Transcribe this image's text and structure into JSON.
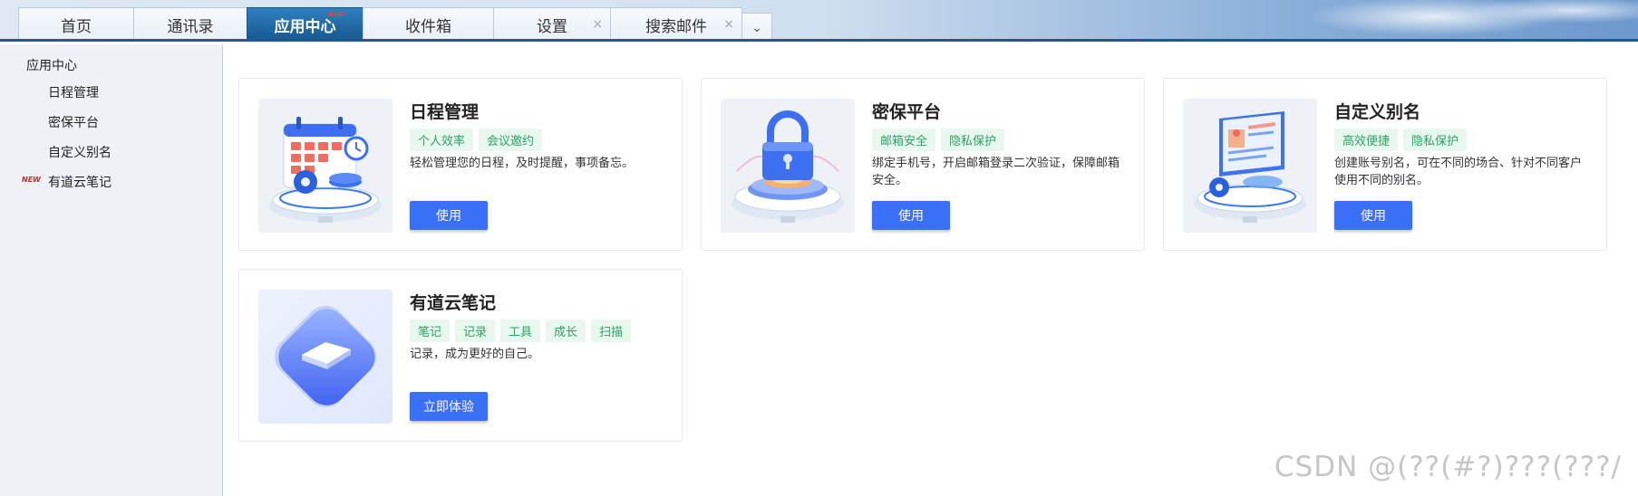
{
  "tabs": [
    {
      "label": "首页",
      "active": false
    },
    {
      "label": "通讯录",
      "active": false
    },
    {
      "label": "应用中心",
      "active": true,
      "badge": "NEW"
    },
    {
      "label": "收件箱",
      "active": false
    },
    {
      "label": "设置",
      "active": false,
      "closable": true
    },
    {
      "label": "搜索邮件",
      "active": false,
      "closable": true
    }
  ],
  "tab_close_glyph": "×",
  "tab_more_glyph": "⌄",
  "sidebar": {
    "heading": "应用中心",
    "items": [
      {
        "label": "日程管理"
      },
      {
        "label": "密保平台"
      },
      {
        "label": "自定义别名"
      },
      {
        "label": "有道云笔记",
        "badge": "NEW"
      }
    ]
  },
  "cards": [
    {
      "title": "日程管理",
      "tags": [
        "个人效率",
        "会议邀约"
      ],
      "desc": "轻松管理您的日程，及时提醒，事项备忘。",
      "button": "使用",
      "icon": "calendar-icon"
    },
    {
      "title": "密保平台",
      "tags": [
        "邮箱安全",
        "隐私保护"
      ],
      "desc": "绑定手机号，开启邮箱登录二次验证，保障邮箱安全。",
      "button": "使用",
      "icon": "lock-icon"
    },
    {
      "title": "自定义别名",
      "tags": [
        "高效便捷",
        "隐私保护"
      ],
      "desc": "创建账号别名，可在不同的场合、针对不同客户使用不同的别名。",
      "button": "使用",
      "icon": "id-card-icon"
    },
    {
      "title": "有道云笔记",
      "tags": [
        "笔记",
        "记录",
        "工具",
        "成长",
        "扫描"
      ],
      "desc": "记录，成为更好的自己。",
      "button": "立即体验",
      "icon": "note-app-icon"
    }
  ],
  "watermark": "CSDN @(??(#?)???(???/",
  "colors": {
    "accent": "#3a6ff7",
    "active_tab": "#1b5b93",
    "tag_bg": "#e9f8ef",
    "tag_text": "#2aa363",
    "new_badge": "#e22222"
  }
}
